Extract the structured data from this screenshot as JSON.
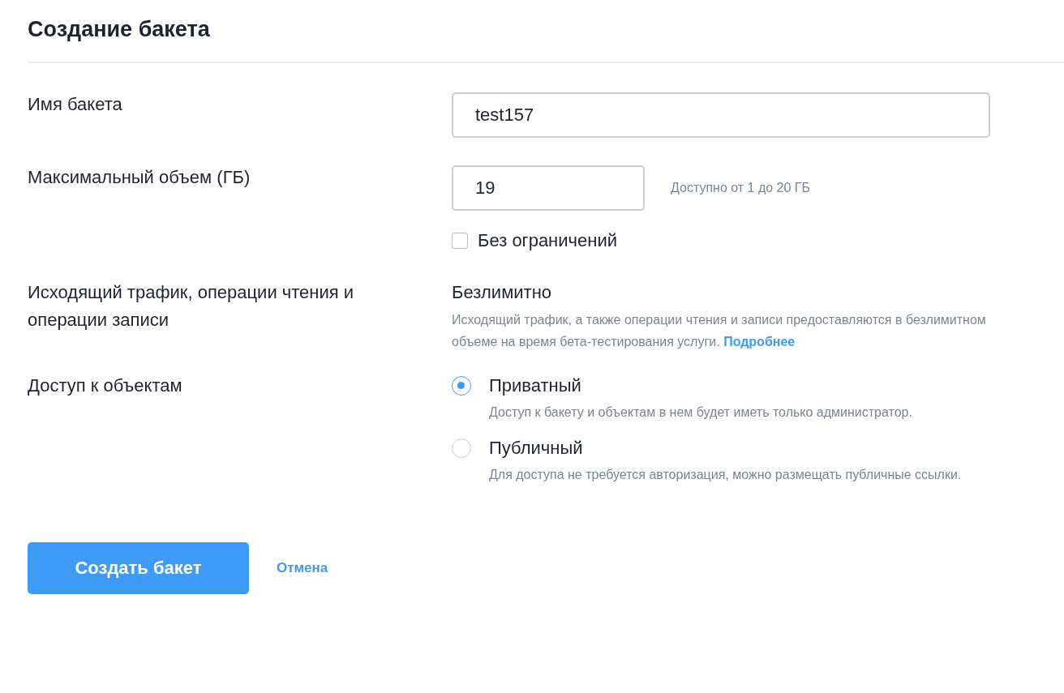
{
  "title": "Создание бакета",
  "bucket_name": {
    "label": "Имя бакета",
    "value": "test157"
  },
  "max_volume": {
    "label": "Максимальный объем (ГБ)",
    "value": "19",
    "hint": "Доступно от 1 до 20 ГБ",
    "unlimited": {
      "label": "Без ограничений",
      "checked": false
    }
  },
  "traffic": {
    "label": "Исходящий трафик, операции чтения и операции записи",
    "value": "Безлимитно",
    "description": "Исходящий трафик, а также операции чтения и записи предоставляются в безлимитном объеме на время бета-тестирования услуги.",
    "link": "Подробнее"
  },
  "access": {
    "label": "Доступ к объектам",
    "options": [
      {
        "label": "Приватный",
        "description": "Доступ к бакету и объектам в нем будет иметь только администратор.",
        "selected": true
      },
      {
        "label": "Публичный",
        "description": "Для доступа не требуется авторизация, можно размещать публичные ссылки.",
        "selected": false
      }
    ]
  },
  "buttons": {
    "submit": "Создать бакет",
    "cancel": "Отмена"
  }
}
